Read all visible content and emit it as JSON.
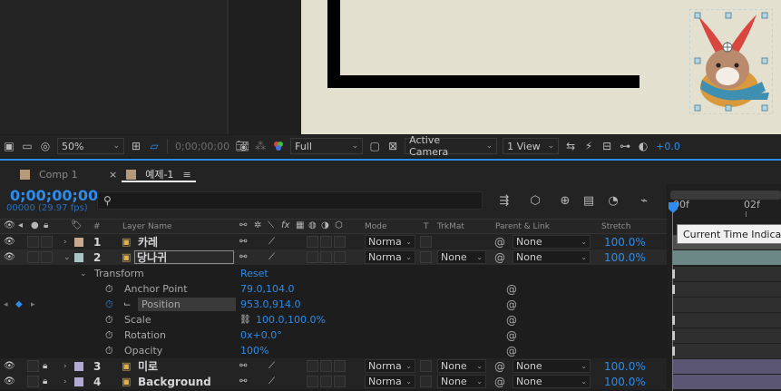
{
  "viewer_toolbar": {
    "zoom": "50%",
    "timecode": "0;00;00;00",
    "resolution": "Full",
    "camera": "Active Camera",
    "view_layout": "1 View",
    "exposure": "+0.0"
  },
  "tabs": [
    {
      "label": "Comp 1"
    },
    {
      "label": "예제-1"
    }
  ],
  "timeline": {
    "current_time": "0;00;00;00",
    "frame_info": "00000 (29.97 fps)",
    "search_placeholder": "",
    "tooltip": "Current Time Indicat",
    "ruler_ticks": [
      "00f",
      "02f"
    ]
  },
  "columns": {
    "num": "#",
    "layer_name": "Layer Name",
    "mode": "Mode",
    "t": "T",
    "trkmat": "TrkMat",
    "parent": "Parent & Link",
    "stretch": "Stretch"
  },
  "layers": [
    {
      "num": "1",
      "name": "카레",
      "mode": "Norma",
      "trkmat": "",
      "parent": "None",
      "stretch": "100.0%",
      "swatch": "#c9a98b"
    },
    {
      "num": "2",
      "name": "당나귀",
      "mode": "Norma",
      "trkmat": "None",
      "parent": "None",
      "stretch": "100.0%",
      "swatch": "#a9c4c4"
    },
    {
      "num": "3",
      "name": "미로",
      "mode": "Norma",
      "trkmat": "None",
      "parent": "None",
      "stretch": "100.0%",
      "swatch": "#b2a9d4"
    },
    {
      "num": "4",
      "name": "Background",
      "mode": "Norma",
      "trkmat": "None",
      "parent": "None",
      "stretch": "100.0%",
      "swatch": "#b2a9d4"
    }
  ],
  "transform": {
    "label": "Transform",
    "reset": "Reset",
    "properties": [
      {
        "name": "Anchor Point",
        "value": "79.0,104.0"
      },
      {
        "name": "Position",
        "value": "953.0,914.0"
      },
      {
        "name": "Scale",
        "value": "100.0,100.0%"
      },
      {
        "name": "Rotation",
        "value": "0x+0.0°"
      },
      {
        "name": "Opacity",
        "value": "100%"
      }
    ]
  },
  "colors": {
    "accent": "#2d8ceb",
    "comp_background": "#e4e0cf",
    "panel": "#232323"
  }
}
